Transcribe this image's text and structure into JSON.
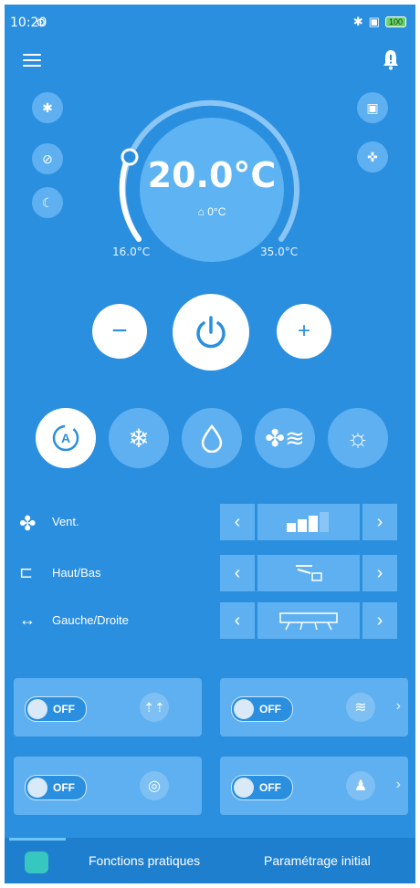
{
  "status_bar": {
    "time": "10:20",
    "battery": "100"
  },
  "thermostat": {
    "target_temp": "20.0°C",
    "outdoor_temp": "0°C",
    "min_label": "16.0°C",
    "max_label": "35.0°C"
  },
  "controls": {
    "minus": "−",
    "plus": "+"
  },
  "modes": [
    {
      "icon": "auto-mode-icon",
      "active": true
    },
    {
      "icon": "snowflake-icon",
      "active": false
    },
    {
      "icon": "droplet-icon",
      "active": false
    },
    {
      "icon": "fan-mode-icon",
      "active": false
    },
    {
      "icon": "sun-icon",
      "active": false
    }
  ],
  "rows": [
    {
      "label": "Vent.",
      "icon": "fan-icon",
      "fan_level": 3,
      "fan_max": 4
    },
    {
      "label": "Haut/Bas",
      "icon": "vertical-swing-icon"
    },
    {
      "label": "Gauche/Droite",
      "icon": "horizontal-swing-icon"
    }
  ],
  "toggles": [
    {
      "state": "OFF",
      "icon": "turbo-icon",
      "has_chevron": false
    },
    {
      "state": "OFF",
      "icon": "airflow-icon",
      "has_chevron": true
    },
    {
      "state": "OFF",
      "icon": "bulb-icon",
      "has_chevron": false
    },
    {
      "state": "OFF",
      "icon": "person-sensor-icon",
      "has_chevron": true
    }
  ],
  "tabs": {
    "functions": "Fonctions pratiques",
    "settings": "Paramétrage initial"
  },
  "colors": {
    "background": "#2b8fe0",
    "accent_light": "#5eb0f0",
    "white": "#ffffff"
  }
}
